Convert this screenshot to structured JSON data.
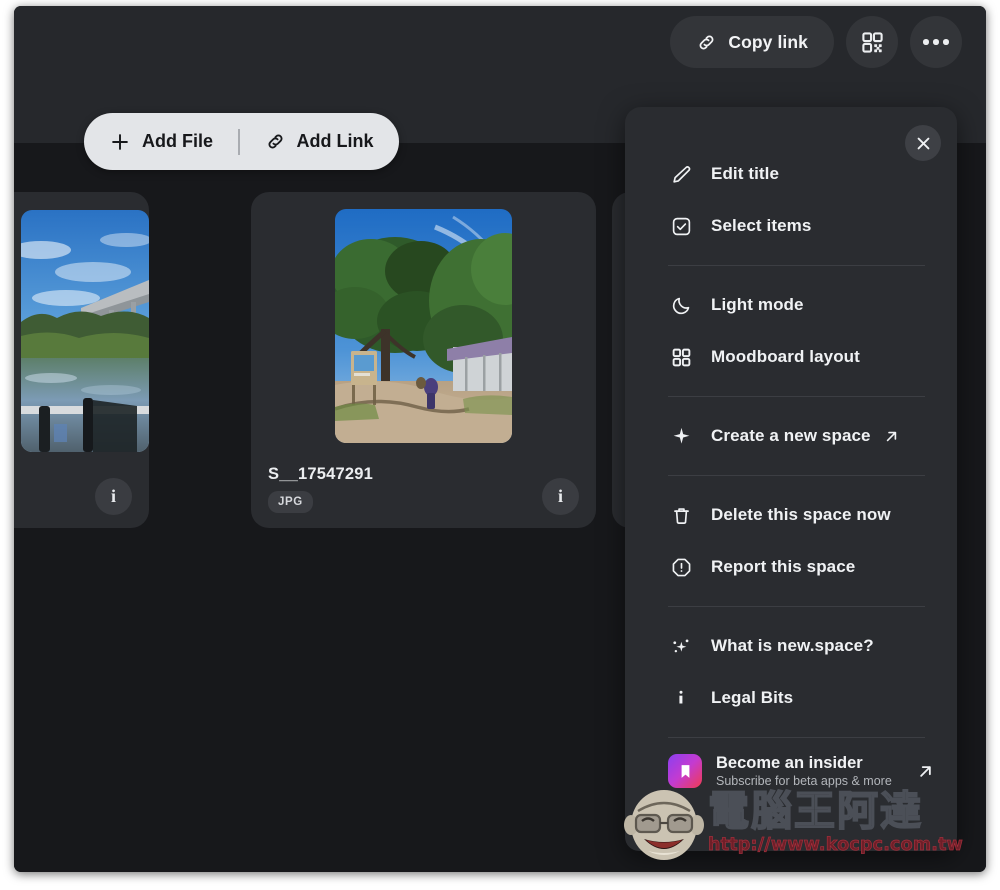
{
  "top_actions": {
    "copy_link": {
      "label": "Copy link",
      "icon": "link-icon"
    },
    "qr": {
      "icon": "qr-code-icon"
    },
    "more": {
      "icon": "more-horizontal-icon"
    }
  },
  "add_pill": {
    "add_file": {
      "label": "Add File",
      "icon": "plus-icon"
    },
    "add_link": {
      "label": "Add Link",
      "icon": "link-icon"
    }
  },
  "cards": [
    {
      "caption": "",
      "ext": "",
      "info_icon": "info-icon"
    },
    {
      "caption": "S__17547291",
      "ext": "JPG",
      "info_icon": "info-icon"
    },
    {
      "caption": "",
      "ext": "",
      "info_icon": "info-icon"
    }
  ],
  "menu": {
    "close_icon": "close-icon",
    "items": [
      {
        "label": "Edit title",
        "icon": "pencil-icon",
        "external": false
      },
      {
        "label": "Select items",
        "icon": "checkbox-icon",
        "external": false
      },
      {
        "sep": true
      },
      {
        "label": "Light mode",
        "icon": "moon-icon",
        "external": false
      },
      {
        "label": "Moodboard layout",
        "icon": "grid-icon",
        "external": false
      },
      {
        "sep": true
      },
      {
        "label": "Create a new space",
        "icon": "sparkle-icon",
        "external": true
      },
      {
        "sep": true
      },
      {
        "label": "Delete this space now",
        "icon": "trash-icon",
        "external": false
      },
      {
        "label": "Report this space",
        "icon": "alert-octagon-icon",
        "external": false
      },
      {
        "sep": true
      },
      {
        "label": "What is new.space?",
        "icon": "sparkles-icon",
        "external": false
      },
      {
        "label": "Legal Bits",
        "icon": "info-i-icon",
        "external": false
      },
      {
        "sep": true
      }
    ],
    "insider": {
      "title": "Become an insider",
      "subtitle": "Subscribe for beta apps & more",
      "icon": "bookmark-badge-icon",
      "arrow_icon": "arrow-up-right-icon"
    }
  },
  "watermark": {
    "name": "電腦王阿達",
    "url": "http://www.kocpc.com.tw",
    "face_icon": "mascot-face-icon"
  },
  "colors": {
    "window_bg": "#1f2125",
    "toolbar_bg": "#26282c",
    "canvas_bg": "#17181b",
    "card_bg": "#2a2c30",
    "menu_bg": "#2a2c30",
    "pill_light": "#e3e5e8",
    "text_primary": "#f0f2f4",
    "text_muted": "#b3b6bb",
    "insider_gradient_start": "#8b3ff0",
    "insider_gradient_end": "#f03b52",
    "watermark_url": "#a32f3c"
  }
}
